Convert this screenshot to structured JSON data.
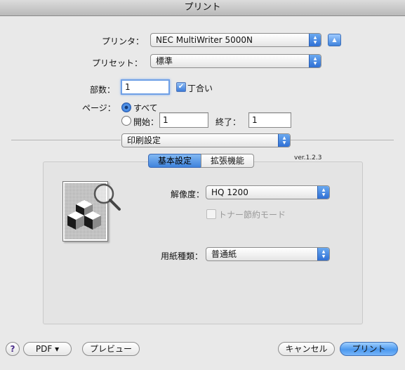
{
  "window": {
    "title": "プリント"
  },
  "printer": {
    "label": "プリンタ：",
    "value": "NEC MultiWriter 5000N"
  },
  "preset": {
    "label": "プリセット：",
    "value": "標準"
  },
  "copies": {
    "label": "部数：",
    "value": "1",
    "collate_label": "丁合い",
    "collate_checked": true
  },
  "pages": {
    "label": "ページ：",
    "all_label": "すべて",
    "from_label": "開始：",
    "from_value": "1",
    "to_label": "終了：",
    "to_value": "1",
    "selected": "all"
  },
  "section_popup": {
    "value": "印刷設定"
  },
  "tabs": [
    {
      "label": "基本設定",
      "active": true
    },
    {
      "label": "拡張機能",
      "active": false
    }
  ],
  "version": "ver.1.2.3",
  "resolution": {
    "label": "解像度：",
    "value": "HQ 1200"
  },
  "toner_save": {
    "label": "トナー節約モード",
    "checked": false,
    "enabled": false
  },
  "paper_type": {
    "label": "用紙種類：",
    "value": "普通紙"
  },
  "footer": {
    "help_label": "?",
    "pdf_label": "PDF ▾",
    "preview_label": "プレビュー",
    "cancel_label": "キャンセル",
    "print_label": "プリント"
  },
  "colors": {
    "accent": "#3f83dc",
    "window_bg": "#e9e9e9"
  },
  "icons": {
    "popup_arrows": "up-down-arrows-icon",
    "disclosure": "disclosure-triangle-icon",
    "magnifier": "magnifier-icon"
  }
}
